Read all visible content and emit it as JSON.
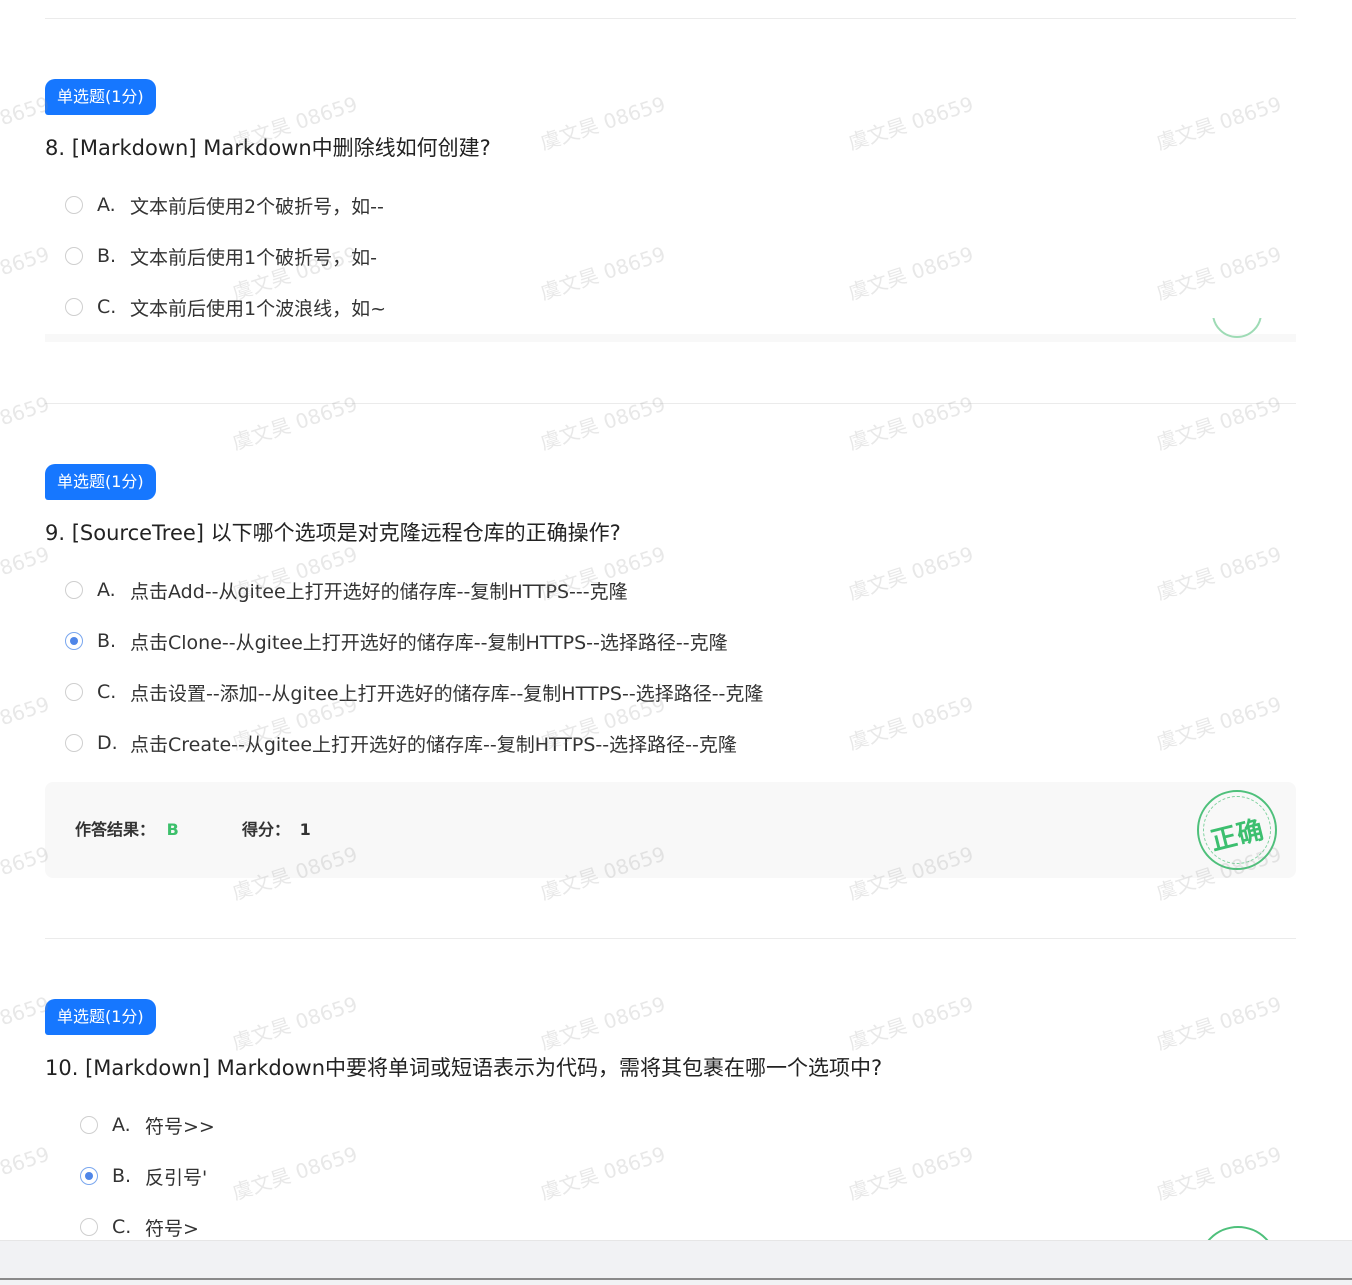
{
  "questions": [
    {
      "tag": "单选题(1分)",
      "title": "8. [Markdown] Markdown中删除线如何创建?",
      "options": [
        {
          "letter": "A.",
          "text": "文本前后使用2个破折号，如--",
          "checked": false
        },
        {
          "letter": "B.",
          "text": "文本前后使用1个破折号，如-",
          "checked": false
        },
        {
          "letter": "C.",
          "text": "文本前后使用1个波浪线，如~",
          "checked": false
        }
      ]
    },
    {
      "tag": "单选题(1分)",
      "title": "9. [SourceTree] 以下哪个选项是对克隆远程仓库的正确操作?",
      "options": [
        {
          "letter": "A.",
          "text": "点击Add--从gitee上打开选好的储存库--复制HTTPS---克隆",
          "checked": false
        },
        {
          "letter": "B.",
          "text": "点击Clone--从gitee上打开选好的储存库--复制HTTPS--选择路径--克隆",
          "checked": true
        },
        {
          "letter": "C.",
          "text": "点击设置--添加--从gitee上打开选好的储存库--复制HTTPS--选择路径--克隆",
          "checked": false
        },
        {
          "letter": "D.",
          "text": "点击Create--从gitee上打开选好的储存库--复制HTTPS--选择路径--克隆",
          "checked": false
        }
      ],
      "result": {
        "answer_label": "作答结果：",
        "answer_value": "B",
        "score_label": "得分：",
        "score_value": "1",
        "stamp": "正确"
      }
    },
    {
      "tag": "单选题(1分)",
      "title": "10. [Markdown] Markdown中要将单词或短语表示为代码，需将其包裹在哪一个选项中?",
      "options": [
        {
          "letter": "A.",
          "text": "符号>>",
          "checked": false
        },
        {
          "letter": "B.",
          "text": "反引号'",
          "checked": true
        },
        {
          "letter": "C.",
          "text": "符号>",
          "checked": false
        }
      ]
    }
  ],
  "watermark": "虞文昊 08659",
  "colors": {
    "tag_bg": "#1677ff",
    "correct_green": "#3cc06b",
    "radio_checked": "#4f86e8"
  }
}
